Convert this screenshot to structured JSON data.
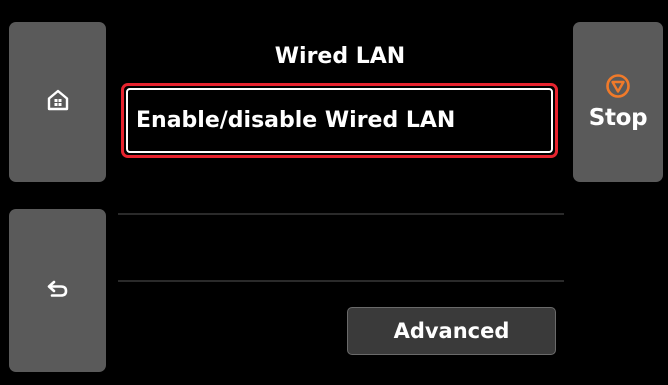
{
  "header": {
    "title": "Wired LAN"
  },
  "menu": {
    "items": [
      {
        "label": "Enable/disable Wired LAN",
        "selected": true
      }
    ]
  },
  "buttons": {
    "home_icon": "home-icon",
    "back_icon": "back-arrow-icon",
    "stop_icon": "stop-icon",
    "stop_label": "Stop",
    "advanced_label": "Advanced"
  },
  "colors": {
    "background": "#000000",
    "side_button": "#5a5a5a",
    "selection_border": "#e7242f",
    "stop_icon": "#f07a2a"
  }
}
